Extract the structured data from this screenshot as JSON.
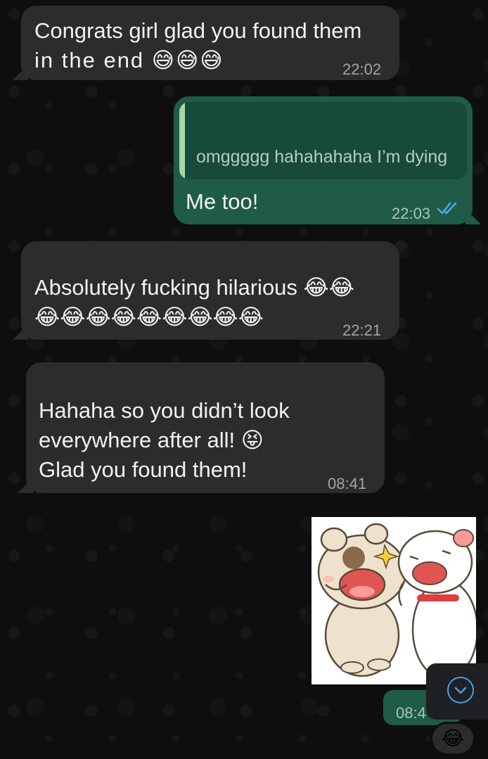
{
  "messages": [
    {
      "direction": "incoming",
      "text_line1": "Congrats girl glad you found them",
      "text_line2": "in the end 😅😅😅",
      "time": "22:02"
    },
    {
      "direction": "outgoing",
      "quoted_text": "omggggg hahahahaha I’m dying",
      "text": "Me too!",
      "time": "22:03",
      "status": "read"
    },
    {
      "direction": "incoming",
      "text_line1": "Absolutely fucking hilarious 😂😂",
      "text_line2": "😂😂😂😂😂😂😂😂😂",
      "time": "22:21"
    },
    {
      "direction": "incoming",
      "text_line1": "Hahaha so you didn’t look",
      "text_line2": "everywhere after all! 😝",
      "text_line3": "Glad you found them!",
      "time": "08:41"
    },
    {
      "direction": "outgoing",
      "type": "sticker",
      "sticker_description_icon": "dog-laughing-sticker",
      "time": "08:4",
      "reaction": "😂"
    }
  ],
  "colors": {
    "incoming_bubble": "#2b2c2e",
    "outgoing_bubble": "#1f5b47",
    "read_check": "#53a6ea",
    "background": "#0e0e0e"
  },
  "controls": {
    "scroll_down_icon": "chevron-down-circle-icon"
  }
}
